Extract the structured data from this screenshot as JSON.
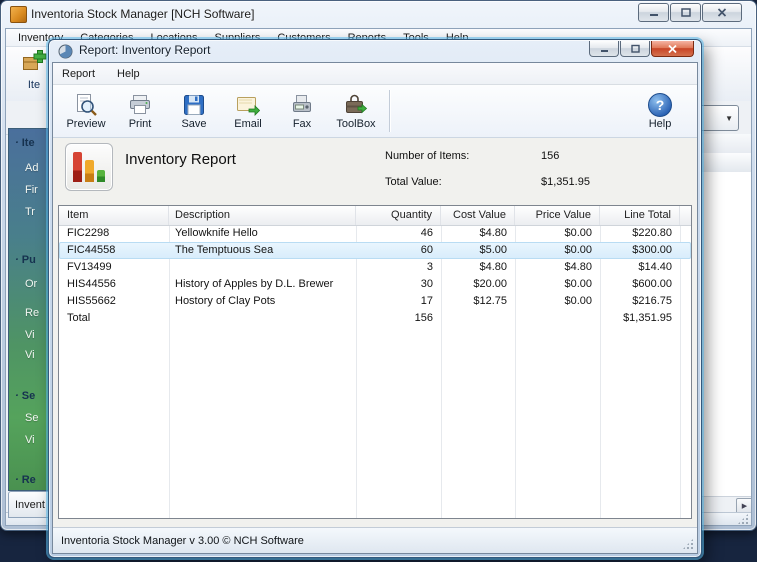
{
  "main_window": {
    "title": "Inventoria Stock Manager [NCH Software]",
    "menu": [
      "Inventory",
      "Categories",
      "Locations",
      "Suppliers",
      "Customers",
      "Reports",
      "Tools",
      "Help"
    ],
    "toolbar": {
      "add_item_label": "Ite"
    },
    "sidebar": {
      "sections": [
        {
          "header": "Ite",
          "links": [
            "Ad",
            "Fir",
            "Tr"
          ]
        },
        {
          "header": "Pu",
          "links": [
            "Or",
            "Re",
            "Vi",
            "Vi"
          ]
        },
        {
          "header": "Se",
          "links": [
            "Se",
            "Vi"
          ]
        },
        {
          "header": "Re",
          "links": []
        }
      ]
    },
    "bottom_tab_label": "Invent"
  },
  "dialog": {
    "title": "Report: Inventory Report",
    "menu": [
      "Report",
      "Help"
    ],
    "toolbar": {
      "preview": "Preview",
      "print": "Print",
      "save": "Save",
      "email": "Email",
      "fax": "Fax",
      "toolbox": "ToolBox",
      "help": "Help"
    },
    "report_header": {
      "title": "Inventory Report",
      "items_label": "Number of Items:",
      "items_value": "156",
      "total_label": "Total Value:",
      "total_value": "$1,351.95"
    },
    "table": {
      "columns": [
        "Item",
        "Description",
        "Quantity",
        "Cost Value",
        "Price Value",
        "Line Total"
      ],
      "rows": [
        [
          "FIC2298",
          "Yellowknife Hello",
          "46",
          "$4.80",
          "$0.00",
          "$220.80"
        ],
        [
          "FIC44558",
          "The Temptuous Sea",
          "60",
          "$5.00",
          "$0.00",
          "$300.00"
        ],
        [
          "FV13499",
          "",
          "3",
          "$4.80",
          "$4.80",
          "$14.40"
        ],
        [
          "HIS44556",
          "History of Apples by D.L. Brewer",
          "30",
          "$20.00",
          "$0.00",
          "$600.00"
        ],
        [
          "HIS55662",
          "Hostory of Clay Pots",
          "17",
          "$12.75",
          "$0.00",
          "$216.75"
        ],
        [
          "Total",
          "",
          "156",
          "",
          "",
          "$1,351.95"
        ]
      ],
      "selected_row_index": 1
    },
    "status_text": "Inventoria Stock Manager v 3.00 © NCH Software"
  },
  "icons": {
    "bullet": "·",
    "combo_arrow": "▼",
    "hscroll_arrow": "▶",
    "help_glyph": "?"
  },
  "colors": {
    "selection": "#d7ecfb",
    "close_button": "#c84426",
    "sidebar_top": "#4a6f9c",
    "sidebar_bottom": "#4a9150",
    "desktop": "#17253f"
  }
}
